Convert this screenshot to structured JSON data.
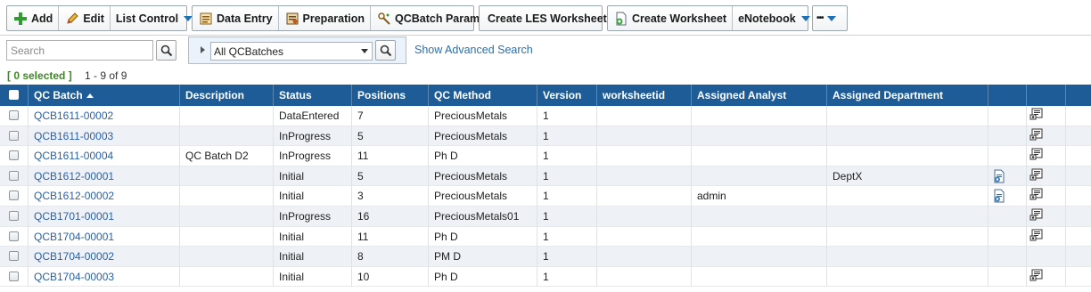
{
  "toolbar": {
    "add_label": "Add",
    "edit_label": "Edit",
    "list_control_label": "List Control",
    "data_entry_label": "Data Entry",
    "preparation_label": "Preparation",
    "qcbatch_params_label": "QCBatch Params",
    "create_les_worksheet_label": "Create LES Worksheet",
    "create_worksheet_label": "Create Worksheet",
    "enotebook_label": "eNotebook",
    "more_label": "•••"
  },
  "search": {
    "placeholder": "Search",
    "filter_value": "All QCBatches",
    "advanced_link": "Show Advanced Search"
  },
  "status": {
    "selected": "[ 0 selected ]",
    "range": "1 - 9 of 9"
  },
  "columns": {
    "qc_batch": "QC Batch",
    "description": "Description",
    "status": "Status",
    "positions": "Positions",
    "qc_method": "QC Method",
    "version": "Version",
    "worksheetid": "worksheetid",
    "assigned_analyst": "Assigned Analyst",
    "assigned_department": "Assigned Department"
  },
  "rows": [
    {
      "qc_batch": "QCB1611-00002",
      "description": "",
      "status": "DataEntered",
      "positions": "7",
      "qc_method": "PreciousMetals",
      "version": "1",
      "worksheetid": "",
      "analyst": "",
      "department": "",
      "has_worksheet_icon": false
    },
    {
      "qc_batch": "QCB1611-00003",
      "description": "",
      "status": "InProgress",
      "positions": "5",
      "qc_method": "PreciousMetals",
      "version": "1",
      "worksheetid": "",
      "analyst": "",
      "department": "",
      "has_worksheet_icon": false
    },
    {
      "qc_batch": "QCB1611-00004",
      "description": "QC Batch D2",
      "status": "InProgress",
      "positions": "11",
      "qc_method": "Ph D",
      "version": "1",
      "worksheetid": "",
      "analyst": "",
      "department": "",
      "has_worksheet_icon": false
    },
    {
      "qc_batch": "QCB1612-00001",
      "description": "",
      "status": "Initial",
      "positions": "5",
      "qc_method": "PreciousMetals",
      "version": "1",
      "worksheetid": "",
      "analyst": "",
      "department": "DeptX",
      "has_worksheet_icon": true
    },
    {
      "qc_batch": "QCB1612-00002",
      "description": "",
      "status": "Initial",
      "positions": "3",
      "qc_method": "PreciousMetals",
      "version": "1",
      "worksheetid": "",
      "analyst": "admin",
      "department": "",
      "has_worksheet_icon": true
    },
    {
      "qc_batch": "QCB1701-00001",
      "description": "",
      "status": "InProgress",
      "positions": "16",
      "qc_method": "PreciousMetals01",
      "version": "1",
      "worksheetid": "",
      "analyst": "",
      "department": "",
      "has_worksheet_icon": false
    },
    {
      "qc_batch": "QCB1704-00001",
      "description": "",
      "status": "Initial",
      "positions": "11",
      "qc_method": "Ph D",
      "version": "1",
      "worksheetid": "",
      "analyst": "",
      "department": "",
      "has_worksheet_icon": false
    },
    {
      "qc_batch": "QCB1704-00002",
      "description": "",
      "status": "Initial",
      "positions": "8",
      "qc_method": "PM D",
      "version": "1",
      "worksheetid": "",
      "analyst": "",
      "department": "",
      "has_worksheet_icon": false
    },
    {
      "qc_batch": "QCB1704-00003",
      "description": "",
      "status": "Initial",
      "positions": "10",
      "qc_method": "Ph D",
      "version": "1",
      "worksheetid": "",
      "analyst": "",
      "department": "",
      "has_worksheet_icon": false
    }
  ],
  "row_action_icons": [
    true,
    true,
    true,
    true,
    true,
    true,
    true,
    false,
    true
  ],
  "colors": {
    "header_bg": "#1e5c97",
    "link": "#2a5fa8",
    "selected_count": "#3a8a1e",
    "alt_row": "#eef2f6"
  }
}
